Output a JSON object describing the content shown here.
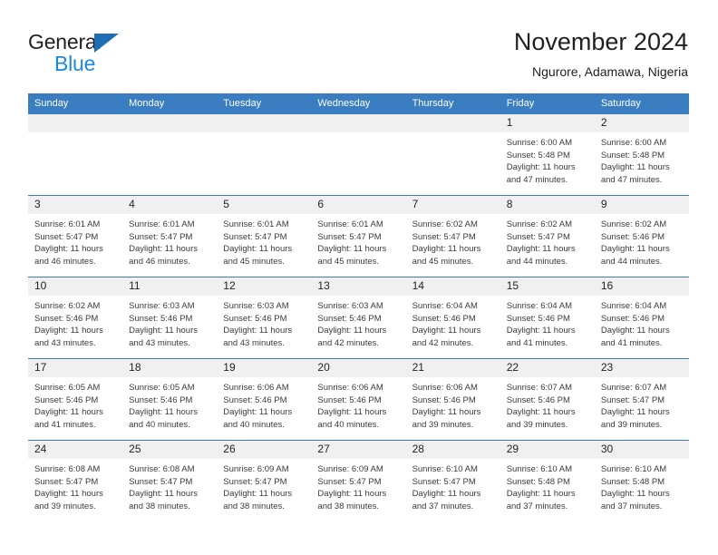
{
  "brand": {
    "name_top": "General",
    "name_bottom": "Blue",
    "triangle_color": "#1f6eb5",
    "blue_color": "#1b8ad6"
  },
  "header": {
    "title": "November 2024",
    "subtitle": "Ngurore, Adamawa, Nigeria"
  },
  "theme": {
    "header_bar": "#3a7dc0",
    "day_band": "#f0f0f0",
    "text": "#231f20"
  },
  "weekdays": [
    "Sunday",
    "Monday",
    "Tuesday",
    "Wednesday",
    "Thursday",
    "Friday",
    "Saturday"
  ],
  "weeks": [
    [
      {
        "day": "",
        "sunrise": "",
        "sunset": "",
        "daylight1": "",
        "daylight2": ""
      },
      {
        "day": "",
        "sunrise": "",
        "sunset": "",
        "daylight1": "",
        "daylight2": ""
      },
      {
        "day": "",
        "sunrise": "",
        "sunset": "",
        "daylight1": "",
        "daylight2": ""
      },
      {
        "day": "",
        "sunrise": "",
        "sunset": "",
        "daylight1": "",
        "daylight2": ""
      },
      {
        "day": "",
        "sunrise": "",
        "sunset": "",
        "daylight1": "",
        "daylight2": ""
      },
      {
        "day": "1",
        "sunrise": "Sunrise: 6:00 AM",
        "sunset": "Sunset: 5:48 PM",
        "daylight1": "Daylight: 11 hours",
        "daylight2": "and 47 minutes."
      },
      {
        "day": "2",
        "sunrise": "Sunrise: 6:00 AM",
        "sunset": "Sunset: 5:48 PM",
        "daylight1": "Daylight: 11 hours",
        "daylight2": "and 47 minutes."
      }
    ],
    [
      {
        "day": "3",
        "sunrise": "Sunrise: 6:01 AM",
        "sunset": "Sunset: 5:47 PM",
        "daylight1": "Daylight: 11 hours",
        "daylight2": "and 46 minutes."
      },
      {
        "day": "4",
        "sunrise": "Sunrise: 6:01 AM",
        "sunset": "Sunset: 5:47 PM",
        "daylight1": "Daylight: 11 hours",
        "daylight2": "and 46 minutes."
      },
      {
        "day": "5",
        "sunrise": "Sunrise: 6:01 AM",
        "sunset": "Sunset: 5:47 PM",
        "daylight1": "Daylight: 11 hours",
        "daylight2": "and 45 minutes."
      },
      {
        "day": "6",
        "sunrise": "Sunrise: 6:01 AM",
        "sunset": "Sunset: 5:47 PM",
        "daylight1": "Daylight: 11 hours",
        "daylight2": "and 45 minutes."
      },
      {
        "day": "7",
        "sunrise": "Sunrise: 6:02 AM",
        "sunset": "Sunset: 5:47 PM",
        "daylight1": "Daylight: 11 hours",
        "daylight2": "and 45 minutes."
      },
      {
        "day": "8",
        "sunrise": "Sunrise: 6:02 AM",
        "sunset": "Sunset: 5:47 PM",
        "daylight1": "Daylight: 11 hours",
        "daylight2": "and 44 minutes."
      },
      {
        "day": "9",
        "sunrise": "Sunrise: 6:02 AM",
        "sunset": "Sunset: 5:46 PM",
        "daylight1": "Daylight: 11 hours",
        "daylight2": "and 44 minutes."
      }
    ],
    [
      {
        "day": "10",
        "sunrise": "Sunrise: 6:02 AM",
        "sunset": "Sunset: 5:46 PM",
        "daylight1": "Daylight: 11 hours",
        "daylight2": "and 43 minutes."
      },
      {
        "day": "11",
        "sunrise": "Sunrise: 6:03 AM",
        "sunset": "Sunset: 5:46 PM",
        "daylight1": "Daylight: 11 hours",
        "daylight2": "and 43 minutes."
      },
      {
        "day": "12",
        "sunrise": "Sunrise: 6:03 AM",
        "sunset": "Sunset: 5:46 PM",
        "daylight1": "Daylight: 11 hours",
        "daylight2": "and 43 minutes."
      },
      {
        "day": "13",
        "sunrise": "Sunrise: 6:03 AM",
        "sunset": "Sunset: 5:46 PM",
        "daylight1": "Daylight: 11 hours",
        "daylight2": "and 42 minutes."
      },
      {
        "day": "14",
        "sunrise": "Sunrise: 6:04 AM",
        "sunset": "Sunset: 5:46 PM",
        "daylight1": "Daylight: 11 hours",
        "daylight2": "and 42 minutes."
      },
      {
        "day": "15",
        "sunrise": "Sunrise: 6:04 AM",
        "sunset": "Sunset: 5:46 PM",
        "daylight1": "Daylight: 11 hours",
        "daylight2": "and 41 minutes."
      },
      {
        "day": "16",
        "sunrise": "Sunrise: 6:04 AM",
        "sunset": "Sunset: 5:46 PM",
        "daylight1": "Daylight: 11 hours",
        "daylight2": "and 41 minutes."
      }
    ],
    [
      {
        "day": "17",
        "sunrise": "Sunrise: 6:05 AM",
        "sunset": "Sunset: 5:46 PM",
        "daylight1": "Daylight: 11 hours",
        "daylight2": "and 41 minutes."
      },
      {
        "day": "18",
        "sunrise": "Sunrise: 6:05 AM",
        "sunset": "Sunset: 5:46 PM",
        "daylight1": "Daylight: 11 hours",
        "daylight2": "and 40 minutes."
      },
      {
        "day": "19",
        "sunrise": "Sunrise: 6:06 AM",
        "sunset": "Sunset: 5:46 PM",
        "daylight1": "Daylight: 11 hours",
        "daylight2": "and 40 minutes."
      },
      {
        "day": "20",
        "sunrise": "Sunrise: 6:06 AM",
        "sunset": "Sunset: 5:46 PM",
        "daylight1": "Daylight: 11 hours",
        "daylight2": "and 40 minutes."
      },
      {
        "day": "21",
        "sunrise": "Sunrise: 6:06 AM",
        "sunset": "Sunset: 5:46 PM",
        "daylight1": "Daylight: 11 hours",
        "daylight2": "and 39 minutes."
      },
      {
        "day": "22",
        "sunrise": "Sunrise: 6:07 AM",
        "sunset": "Sunset: 5:46 PM",
        "daylight1": "Daylight: 11 hours",
        "daylight2": "and 39 minutes."
      },
      {
        "day": "23",
        "sunrise": "Sunrise: 6:07 AM",
        "sunset": "Sunset: 5:47 PM",
        "daylight1": "Daylight: 11 hours",
        "daylight2": "and 39 minutes."
      }
    ],
    [
      {
        "day": "24",
        "sunrise": "Sunrise: 6:08 AM",
        "sunset": "Sunset: 5:47 PM",
        "daylight1": "Daylight: 11 hours",
        "daylight2": "and 39 minutes."
      },
      {
        "day": "25",
        "sunrise": "Sunrise: 6:08 AM",
        "sunset": "Sunset: 5:47 PM",
        "daylight1": "Daylight: 11 hours",
        "daylight2": "and 38 minutes."
      },
      {
        "day": "26",
        "sunrise": "Sunrise: 6:09 AM",
        "sunset": "Sunset: 5:47 PM",
        "daylight1": "Daylight: 11 hours",
        "daylight2": "and 38 minutes."
      },
      {
        "day": "27",
        "sunrise": "Sunrise: 6:09 AM",
        "sunset": "Sunset: 5:47 PM",
        "daylight1": "Daylight: 11 hours",
        "daylight2": "and 38 minutes."
      },
      {
        "day": "28",
        "sunrise": "Sunrise: 6:10 AM",
        "sunset": "Sunset: 5:47 PM",
        "daylight1": "Daylight: 11 hours",
        "daylight2": "and 37 minutes."
      },
      {
        "day": "29",
        "sunrise": "Sunrise: 6:10 AM",
        "sunset": "Sunset: 5:48 PM",
        "daylight1": "Daylight: 11 hours",
        "daylight2": "and 37 minutes."
      },
      {
        "day": "30",
        "sunrise": "Sunrise: 6:10 AM",
        "sunset": "Sunset: 5:48 PM",
        "daylight1": "Daylight: 11 hours",
        "daylight2": "and 37 minutes."
      }
    ]
  ]
}
